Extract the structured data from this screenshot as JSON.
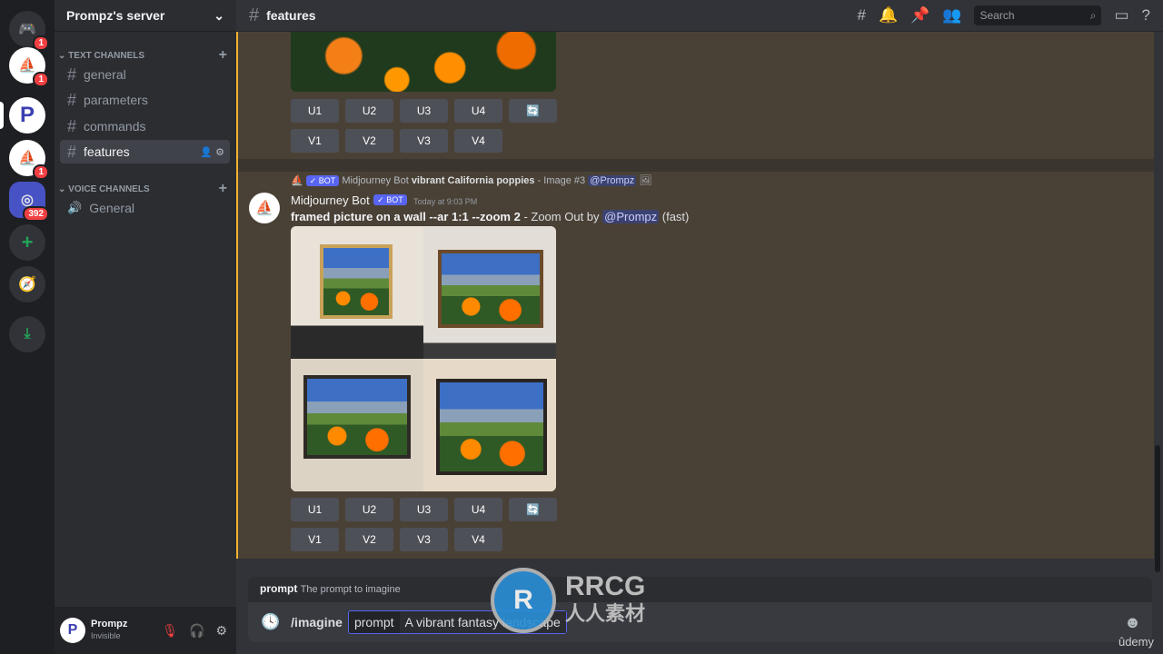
{
  "server": {
    "name": "Prompz's server"
  },
  "rail": {
    "badges": [
      "1",
      "1",
      "1",
      "392"
    ]
  },
  "sidebar": {
    "text_category": "TEXT CHANNELS",
    "voice_category": "VOICE CHANNELS",
    "text_channels": [
      {
        "label": "general"
      },
      {
        "label": "parameters"
      },
      {
        "label": "commands"
      },
      {
        "label": "features"
      }
    ],
    "voice_channels": [
      {
        "label": "General"
      }
    ]
  },
  "user": {
    "name": "Prompz",
    "status": "Invisible"
  },
  "header": {
    "channel": "features",
    "search_placeholder": "Search"
  },
  "message1": {
    "upscale": [
      "U1",
      "U2",
      "U3",
      "U4"
    ],
    "variation": [
      "V1",
      "V2",
      "V3",
      "V4"
    ]
  },
  "message2": {
    "reply_author": "Midjourney Bot",
    "reply_bot": "✓ BOT",
    "reply_prompt": "vibrant California poppies",
    "reply_suffix": " - Image #3 ",
    "reply_mention": "@Prompz",
    "author": "Midjourney Bot",
    "bot_tag": "✓ BOT",
    "timestamp": "Today at 9:03 PM",
    "prompt": "framed picture on a wall --ar 1:1 --zoom 2",
    "suffix": " - Zoom Out by ",
    "mention": "@Prompz",
    "speed": "(fast)",
    "upscale": [
      "U1",
      "U2",
      "U3",
      "U4"
    ],
    "variation": [
      "V1",
      "V2",
      "V3",
      "V4"
    ]
  },
  "composer": {
    "hint_name": "prompt",
    "hint_desc": "The prompt to imagine",
    "command": "/imagine",
    "option": "prompt",
    "value": "A vibrant fantasy landscape"
  },
  "watermark": {
    "text": "RRCG",
    "sub": "人人素材",
    "udemy": "ûdemy"
  }
}
